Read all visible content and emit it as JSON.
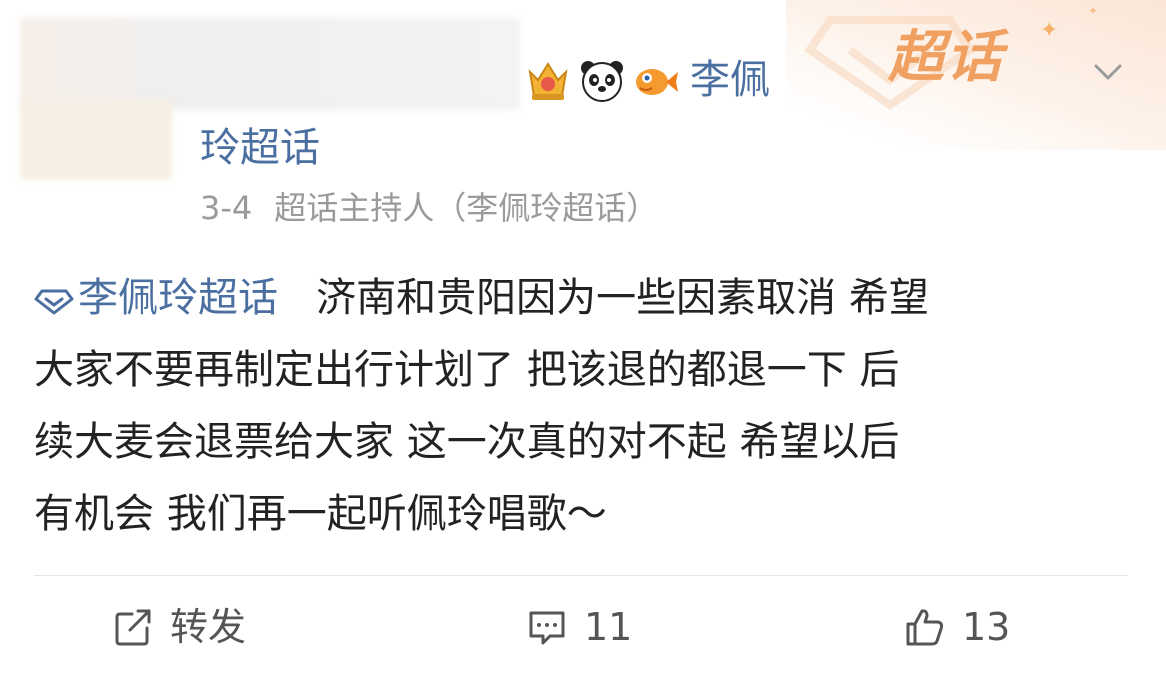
{
  "header": {
    "username": "李佩",
    "badge_icons": [
      "crown-badge-icon",
      "panda-icon",
      "fish-icon"
    ],
    "tag_label": "超话",
    "topic_name": "玲超话"
  },
  "meta": {
    "date": "3-4",
    "role": "超话主持人（李佩玲超话）"
  },
  "post": {
    "topic_link": "李佩玲超话",
    "line1": "济南和贵阳因为一些因素取消 希望",
    "line2": "大家不要再制定出行计划了 把该退的都退一下 后",
    "line3": "续大麦会退票给大家 这一次真的对不起 希望以后",
    "line4": "有机会 我们再一起听佩玲唱歌～"
  },
  "actions": {
    "repost_label": "转发",
    "comment_count": "11",
    "like_count": "13"
  },
  "colors": {
    "link": "#4a6fa0",
    "tag": "#f0a060",
    "text": "#222222",
    "meta": "#9a9a9a"
  }
}
